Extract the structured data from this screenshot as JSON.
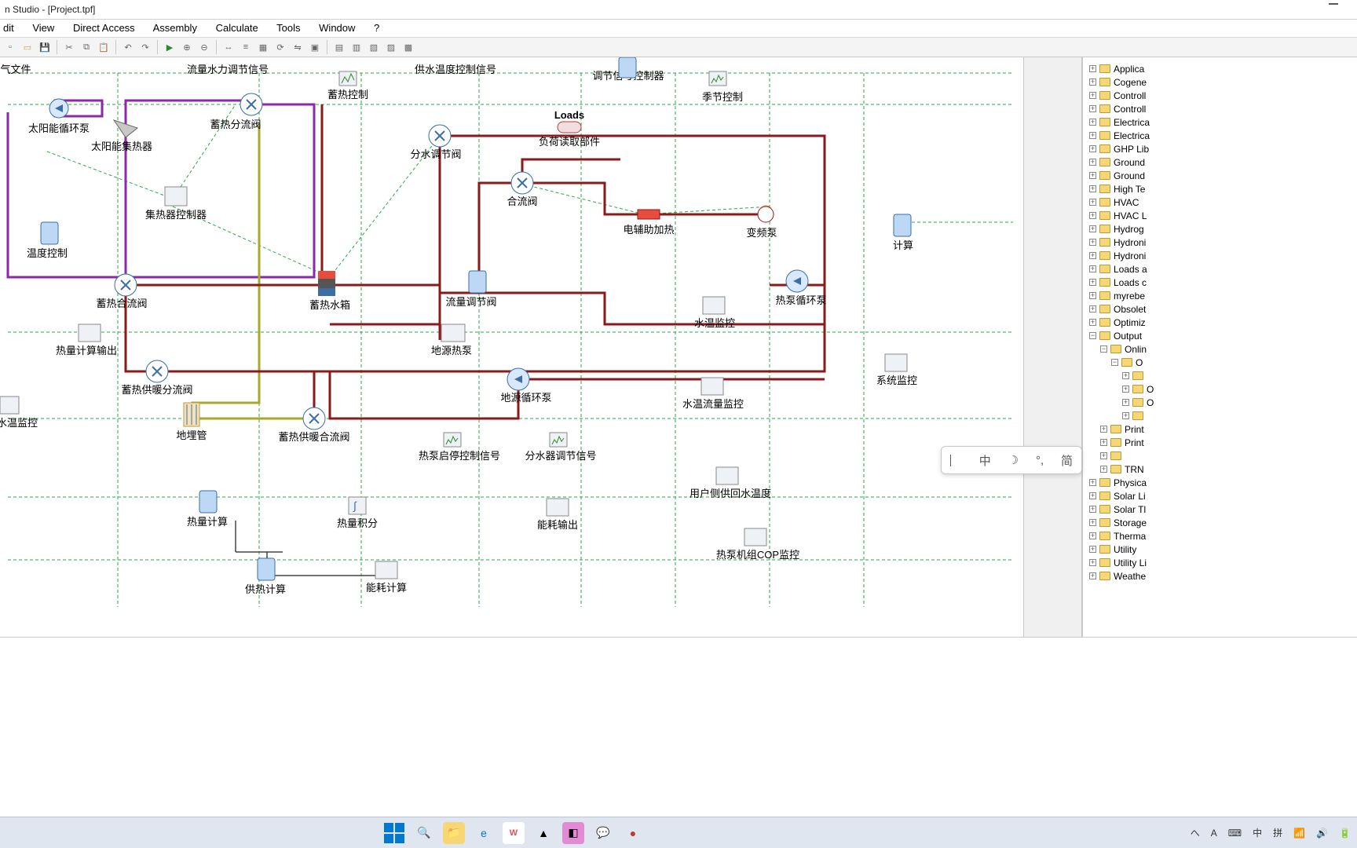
{
  "window": {
    "title": "n Studio - [Project.tpf]"
  },
  "menu": [
    "dit",
    "View",
    "Direct Access",
    "Assembly",
    "Calculate",
    "Tools",
    "Window",
    "?"
  ],
  "nodes": {
    "weather_file": "气文件",
    "flow_hydraulic_signal": "流量水力调节信号",
    "supply_temp_signal": "供水温度控制信号",
    "regulation_controller": "调节信号控制器",
    "season_control": "季节控制",
    "solar_pump": "太阳能循环泵",
    "solar_collector": "太阳能集热器",
    "heat_storage_control": "蓄热控制",
    "heat_diverter": "蓄热分流阀",
    "collector_controller": "集热器控制器",
    "temp_control": "温度控制",
    "water_divider_valve": "分水调节阀",
    "load_reader": "负荷读取部件",
    "loads_label": "Loads",
    "mixing_valve": "合流阀",
    "elec_aux_heater": "电辅助加热",
    "vfd_pump": "变频泵",
    "calc": "计算",
    "heat_merge_valve": "蓄热合流阀",
    "heat_storage_tank": "蓄热水箱",
    "flow_control_valve": "流量调节阀",
    "water_temp_monitor": "水温监控",
    "hp_cycle_pump": "热泵循环泵",
    "heat_calc_output": "热量计算输出",
    "gshp": "地源热泵",
    "system_monitor": "系统监控",
    "heat_supply_diverter": "蓄热供暖分流阀",
    "ground_cycle_pump": "地源循环泵",
    "temp_flow_monitor": "水温流量监控",
    "water_temp_monitor2": "水温监控",
    "borehole": "地埋管",
    "heat_supply_merge": "蓄热供暖合流阀",
    "hp_onoff_signal": "热泵启停控制信号",
    "diverter_signal": "分水器调节信号",
    "user_side_temp": "用户侧供回水温度",
    "heat_calc": "热量计算",
    "heat_integral": "热量积分",
    "energy_output": "能耗输出",
    "cop_monitor": "热泵机组COP监控",
    "supply_calc": "供热计算",
    "energy_calc": "能耗计算"
  },
  "tree": [
    {
      "l": 0,
      "t": "Applica"
    },
    {
      "l": 0,
      "t": "Cogene"
    },
    {
      "l": 0,
      "t": "Controll"
    },
    {
      "l": 0,
      "t": "Controll"
    },
    {
      "l": 0,
      "t": "Electrica"
    },
    {
      "l": 0,
      "t": "Electrica"
    },
    {
      "l": 0,
      "t": "GHP Lib"
    },
    {
      "l": 0,
      "t": "Ground"
    },
    {
      "l": 0,
      "t": "Ground"
    },
    {
      "l": 0,
      "t": "High Te"
    },
    {
      "l": 0,
      "t": "HVAC"
    },
    {
      "l": 0,
      "t": "HVAC L"
    },
    {
      "l": 0,
      "t": "Hydrog"
    },
    {
      "l": 0,
      "t": "Hydroni"
    },
    {
      "l": 0,
      "t": "Hydroni"
    },
    {
      "l": 0,
      "t": "Loads a"
    },
    {
      "l": 0,
      "t": "Loads c"
    },
    {
      "l": 0,
      "t": "myrebe"
    },
    {
      "l": 0,
      "t": "Obsolet"
    },
    {
      "l": 0,
      "t": "Optimiz"
    },
    {
      "l": 0,
      "t": "Output",
      "open": true
    },
    {
      "l": 1,
      "t": "Onlin",
      "open": true
    },
    {
      "l": 2,
      "t": "O",
      "open": true
    },
    {
      "l": 3,
      "t": ""
    },
    {
      "l": 3,
      "t": "O"
    },
    {
      "l": 3,
      "t": "O"
    },
    {
      "l": 3,
      "t": ""
    },
    {
      "l": 1,
      "t": "Print"
    },
    {
      "l": 1,
      "t": "Print"
    },
    {
      "l": 1,
      "t": ""
    },
    {
      "l": 1,
      "t": "TRN"
    },
    {
      "l": 0,
      "t": "Physica"
    },
    {
      "l": 0,
      "t": "Solar Li"
    },
    {
      "l": 0,
      "t": "Solar Tl"
    },
    {
      "l": 0,
      "t": "Storage"
    },
    {
      "l": 0,
      "t": "Therma"
    },
    {
      "l": 0,
      "t": "Utility"
    },
    {
      "l": 0,
      "t": "Utility Li"
    },
    {
      "l": 0,
      "t": "Weathe"
    }
  ],
  "ime": {
    "a": "中",
    "b": "简"
  },
  "tray": {
    "a": "へ",
    "b": "A",
    "c": "⌨",
    "d": "中",
    "e": "拼"
  }
}
